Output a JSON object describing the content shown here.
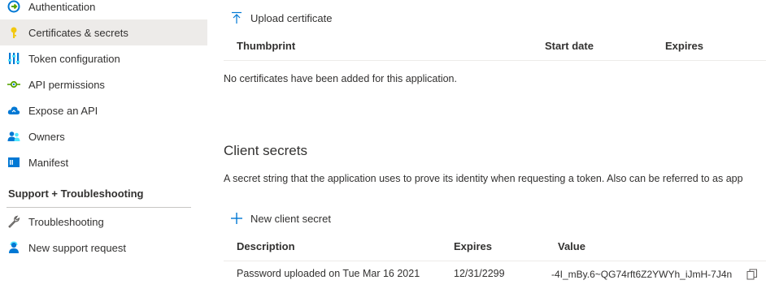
{
  "sidebar": {
    "items": [
      {
        "label": "Authentication",
        "icon": "authentication-icon"
      },
      {
        "label": "Certificates & secrets",
        "icon": "key-icon",
        "active": true
      },
      {
        "label": "Token configuration",
        "icon": "token-config-icon"
      },
      {
        "label": "API permissions",
        "icon": "api-permissions-icon"
      },
      {
        "label": "Expose an API",
        "icon": "cloud-icon"
      },
      {
        "label": "Owners",
        "icon": "owners-icon"
      },
      {
        "label": "Manifest",
        "icon": "manifest-icon"
      }
    ],
    "support_section": {
      "title": "Support + Troubleshooting",
      "items": [
        {
          "label": "Troubleshooting",
          "icon": "wrench-icon"
        },
        {
          "label": "New support request",
          "icon": "support-person-icon"
        }
      ]
    }
  },
  "certificates": {
    "upload_label": "Upload certificate",
    "columns": [
      "Thumbprint",
      "Start date",
      "Expires"
    ],
    "empty_message": "No certificates have been added for this application."
  },
  "client_secrets": {
    "title": "Client secrets",
    "description": "A secret string that the application uses to prove its identity when requesting a token. Also can be referred to as app",
    "new_label": "New client secret",
    "columns": [
      "Description",
      "Expires",
      "Value"
    ],
    "rows": [
      {
        "description": "Password uploaded on Tue Mar 16 2021",
        "expires": "12/31/2299",
        "value": "-4I_mBy.6~QG74rft6Z2YWYh_iJmH-7J4n"
      }
    ]
  },
  "colors": {
    "accent": "#0078d4",
    "active_bg": "#edebe9",
    "text": "#323130"
  }
}
